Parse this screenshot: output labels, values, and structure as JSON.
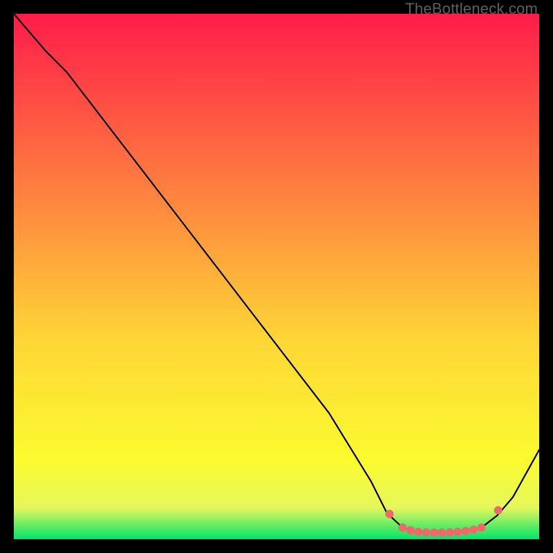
{
  "watermark": "TheBottleneck.com",
  "colors": {
    "background": "#000000",
    "stroke": "#000000",
    "marker": "#ED6A69",
    "gradient_top": "#FF1C49",
    "gradient_mid1": "#FE843F",
    "gradient_mid2": "#FED636",
    "gradient_mid3": "#FBFB2F",
    "gradient_mid4": "#E6F75C",
    "gradient_bottom": "#00E46B"
  },
  "chart_data": {
    "type": "line",
    "title": "",
    "xlabel": "",
    "ylabel": "",
    "x_range": [
      0,
      100
    ],
    "y_range": [
      0,
      100
    ],
    "curve": [
      {
        "x": 0,
        "y": 100
      },
      {
        "x": 6,
        "y": 93
      },
      {
        "x": 10,
        "y": 89
      },
      {
        "x": 20,
        "y": 76
      },
      {
        "x": 30,
        "y": 63
      },
      {
        "x": 40,
        "y": 50
      },
      {
        "x": 50,
        "y": 37
      },
      {
        "x": 60,
        "y": 24
      },
      {
        "x": 68,
        "y": 11
      },
      {
        "x": 71,
        "y": 5
      },
      {
        "x": 74,
        "y": 2.2
      },
      {
        "x": 77,
        "y": 1.3
      },
      {
        "x": 80,
        "y": 1.2
      },
      {
        "x": 83,
        "y": 1.3
      },
      {
        "x": 86,
        "y": 1.6
      },
      {
        "x": 89,
        "y": 2.2
      },
      {
        "x": 92,
        "y": 4.5
      },
      {
        "x": 95,
        "y": 8
      },
      {
        "x": 100,
        "y": 17
      }
    ],
    "markers": [
      {
        "x": 71.5,
        "y": 4.8
      },
      {
        "x": 74,
        "y": 2.2
      },
      {
        "x": 75.5,
        "y": 1.7
      },
      {
        "x": 77,
        "y": 1.4
      },
      {
        "x": 78.5,
        "y": 1.3
      },
      {
        "x": 80,
        "y": 1.25
      },
      {
        "x": 81.5,
        "y": 1.25
      },
      {
        "x": 83,
        "y": 1.3
      },
      {
        "x": 84.5,
        "y": 1.4
      },
      {
        "x": 86,
        "y": 1.55
      },
      {
        "x": 87.5,
        "y": 1.8
      },
      {
        "x": 89,
        "y": 2.2
      },
      {
        "x": 92.2,
        "y": 5.5
      }
    ]
  }
}
